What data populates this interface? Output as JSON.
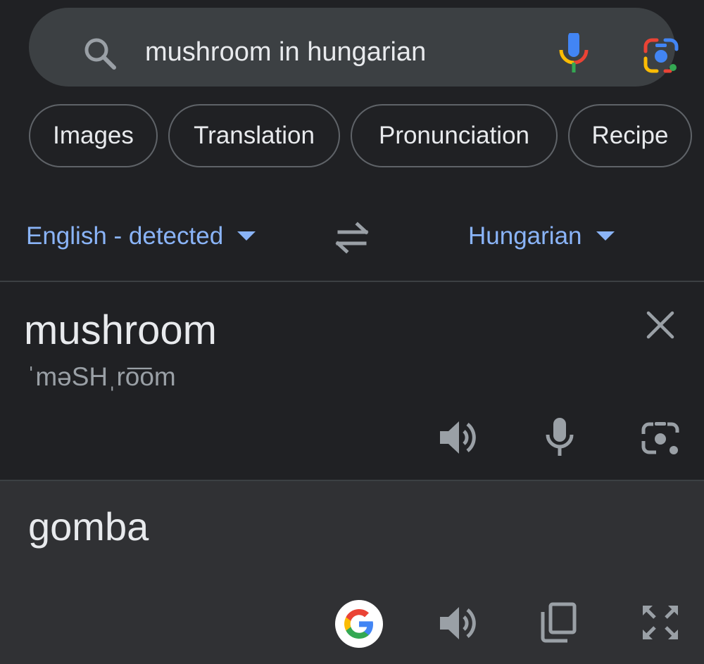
{
  "search": {
    "query": "mushroom in hungarian"
  },
  "chips": [
    {
      "label": "Images"
    },
    {
      "label": "Translation"
    },
    {
      "label": "Pronunciation"
    },
    {
      "label": "Recipe"
    }
  ],
  "translator": {
    "source_language": "English - detected",
    "target_language": "Hungarian",
    "source_text": "mushroom",
    "phonetic": "ˈməSHˌro͞om",
    "translated_text": "gomba"
  },
  "colors": {
    "background": "#202124",
    "search_bar": "#3c4043",
    "result_panel": "#303134",
    "link_blue": "#8ab4f8",
    "icon_gray": "#9aa0a6"
  },
  "icons": {
    "search": "search-icon",
    "voice": "mic-icon",
    "lens": "lens-icon",
    "swap": "swap-icon",
    "clear": "close-icon",
    "listen": "speaker-icon",
    "camera": "camera-icon",
    "google": "google-icon",
    "copy": "copy-icon",
    "fullscreen": "expand-icon"
  }
}
